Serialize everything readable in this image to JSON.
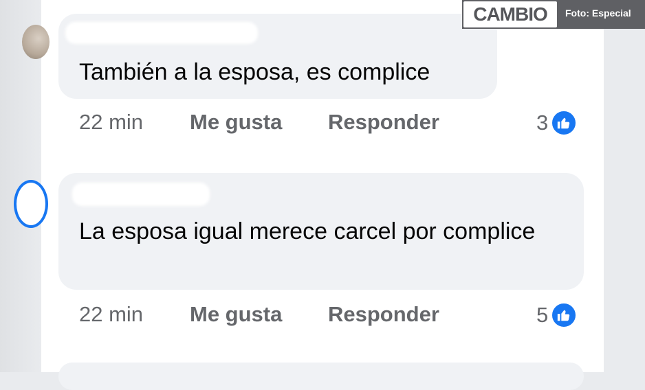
{
  "watermark": {
    "brand": "CAMBIO",
    "credit": "Foto: Especial"
  },
  "comments": [
    {
      "text": "También a la esposa, es complice",
      "time": "22 min",
      "like_label": "Me gusta",
      "reply_label": "Responder",
      "reaction_count": "3",
      "reaction_icon": "thumbs-up-icon"
    },
    {
      "text": "La esposa igual merece carcel por complice",
      "time": "22 min",
      "like_label": "Me gusta",
      "reply_label": "Responder",
      "reaction_count": "5",
      "reaction_icon": "thumbs-up-icon"
    }
  ],
  "colors": {
    "bubble": "#f0f2f5",
    "meta_text": "#65676b",
    "like_blue": "#1877f2",
    "watermark_bg": "#5f6064"
  }
}
